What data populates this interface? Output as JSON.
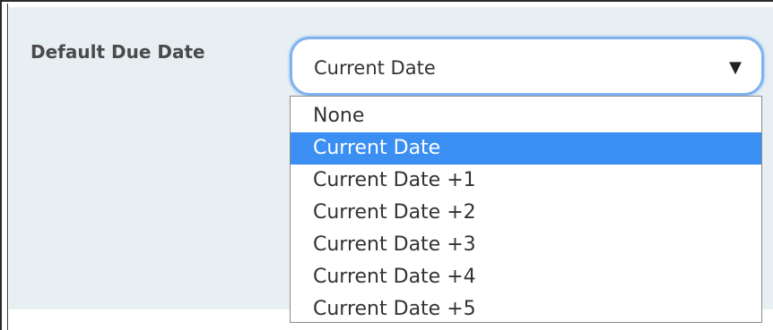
{
  "field": {
    "label": "Default Due Date"
  },
  "select": {
    "value": "Current Date",
    "arrow_icon": "triangle-down-icon",
    "focus_color": "#7fb2f0"
  },
  "dropdown": {
    "selected_index": 1,
    "highlight_color": "#3b8ef2",
    "options": [
      "None",
      "Current Date",
      "Current Date +1",
      "Current Date +2",
      "Current Date +3",
      "Current Date +4",
      "Current Date +5"
    ]
  },
  "panel": {
    "background": "#e7eff2"
  }
}
